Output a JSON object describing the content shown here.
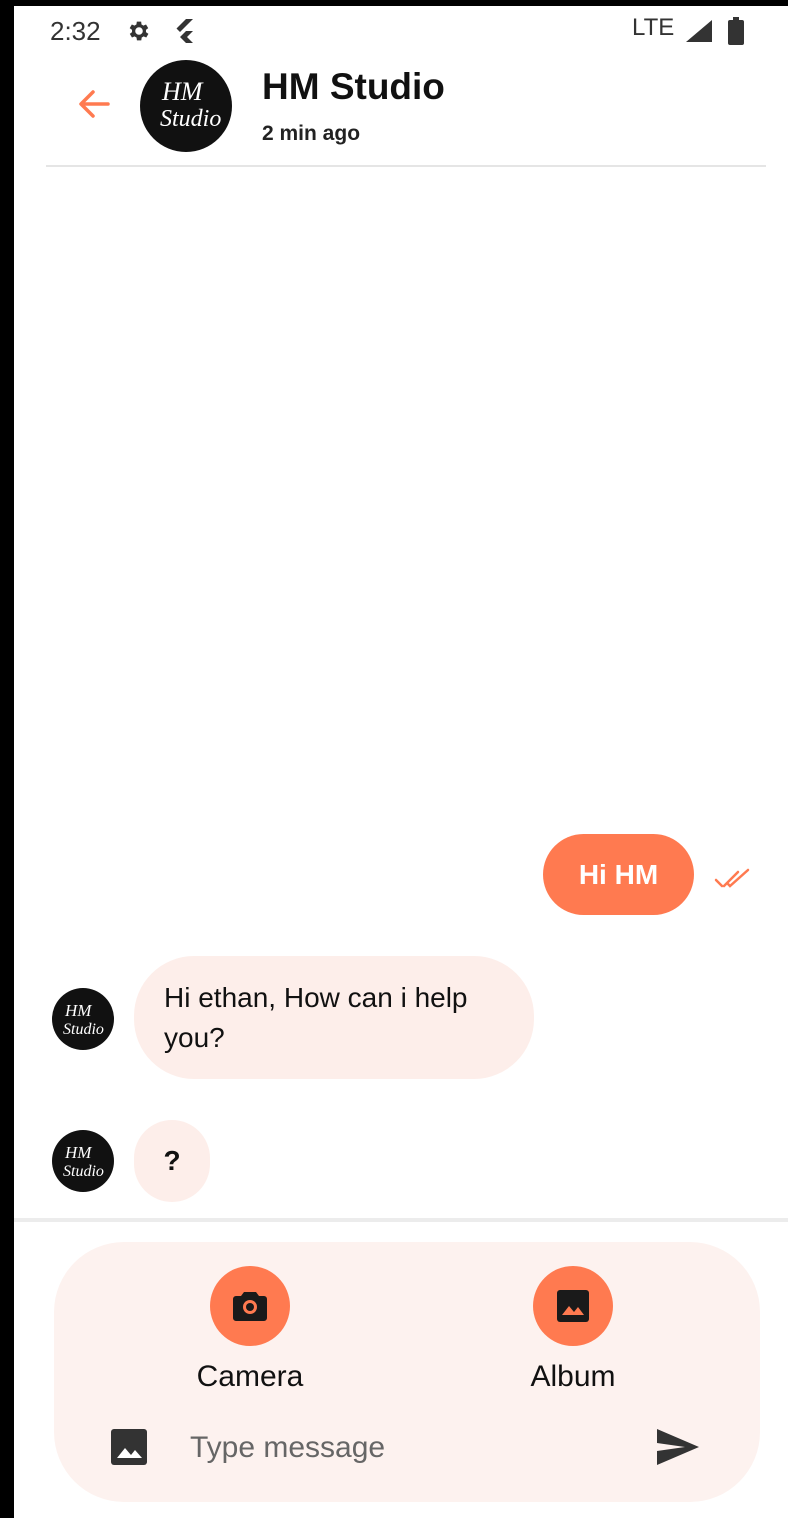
{
  "status_bar": {
    "time": "2:32",
    "network": "LTE"
  },
  "header": {
    "title": "HM Studio",
    "subtitle": "2 min ago",
    "avatar_text": "HM Studio"
  },
  "messages": [
    {
      "direction": "sent",
      "text": "Hi HM",
      "status": "read"
    },
    {
      "direction": "received",
      "text": "Hi ethan, How can i help you?"
    },
    {
      "direction": "received",
      "text": "?"
    }
  ],
  "attachments": {
    "camera_label": "Camera",
    "album_label": "Album"
  },
  "composer": {
    "placeholder": "Type message"
  },
  "colors": {
    "accent": "#ff7a50",
    "received_bubble": "#fdeeea",
    "panel": "#fdf2ef"
  }
}
